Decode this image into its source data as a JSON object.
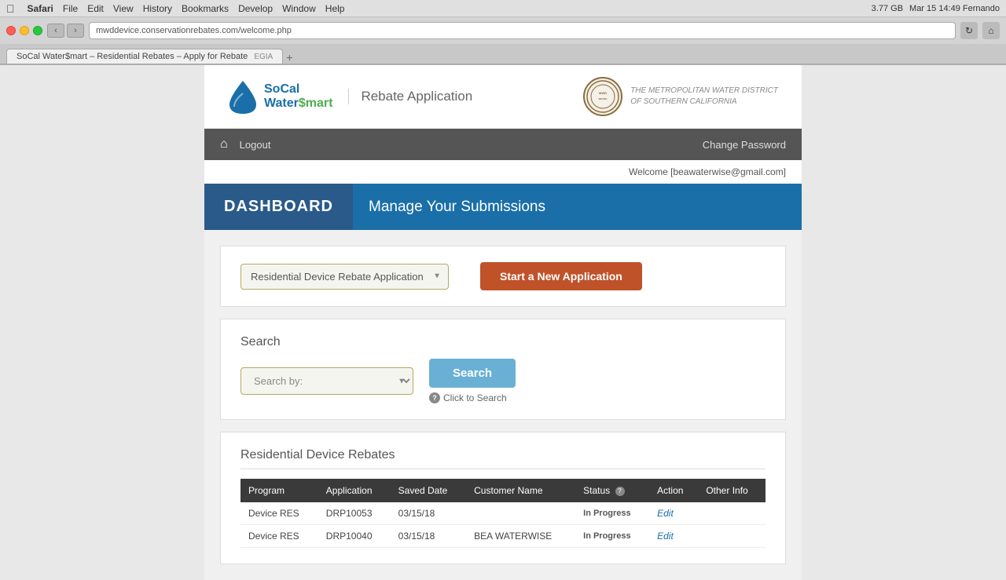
{
  "mac": {
    "menubar_app": "Safari",
    "menus": [
      "File",
      "Edit",
      "View",
      "History",
      "Bookmarks",
      "Develop",
      "Window",
      "Help"
    ],
    "right_info": "Mar 15  14:49  Fernando",
    "storage": "3.77 GB"
  },
  "browser": {
    "address": "mwddevice.conservationrebates.com/welcome.php",
    "tab_title": "SoCal Water$mart – Residential Rebates – Apply for Rebate",
    "tab_right": "EGIA"
  },
  "header": {
    "logo_line1": "SoCal",
    "logo_line2": "Water",
    "logo_smart": "Smart",
    "rebate_label": "Rebate Application",
    "metro_line1": "THE METROPOLITAN WATER DISTRICT",
    "metro_line2": "OF SOUTHERN CALIFORNIA"
  },
  "nav": {
    "logout_label": "Logout",
    "change_password_label": "Change Password"
  },
  "welcome": {
    "text": "Welcome [beawaterwise@gmail.com]"
  },
  "dashboard": {
    "label": "DASHBOARD",
    "subtitle": "Manage Your Submissions"
  },
  "application": {
    "select_value": "Residential Device Rebate Application",
    "select_placeholder": "Residential Device Rebate Application",
    "start_new_label": "Start a New Application"
  },
  "search": {
    "title": "Search",
    "searchby_placeholder": "Search by:",
    "search_button_label": "Search",
    "hint_text": "Click to Search"
  },
  "table": {
    "title": "Residential Device Rebates",
    "columns": [
      "Program",
      "Application",
      "Saved Date",
      "Customer Name",
      "Status",
      "Action",
      "Other Info"
    ],
    "rows": [
      {
        "program": "Device RES",
        "application": "DRP10053",
        "saved_date": "03/15/18",
        "customer_name": "",
        "status": "In Progress",
        "action": "Edit",
        "other_info": ""
      },
      {
        "program": "Device RES",
        "application": "DRP10040",
        "saved_date": "03/15/18",
        "customer_name": "BEA WATERWISE",
        "status": "In Progress",
        "action": "Edit",
        "other_info": ""
      }
    ]
  }
}
